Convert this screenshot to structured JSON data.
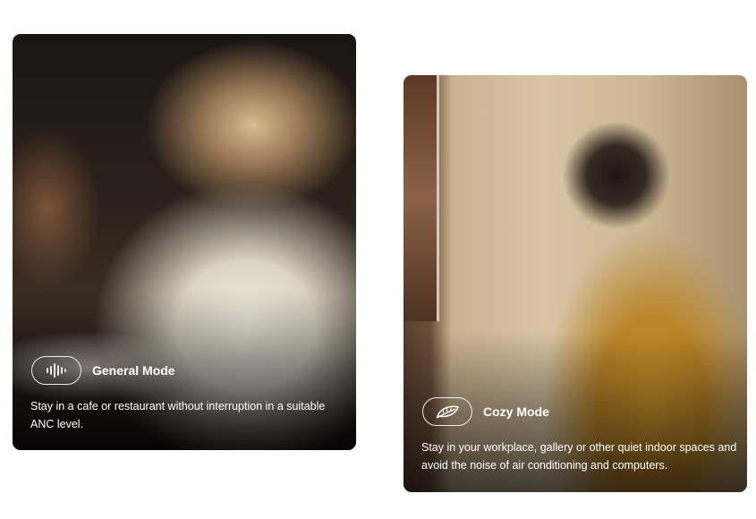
{
  "cards": [
    {
      "mode_title": "General Mode",
      "description": "Stay in a cafe or restaurant without interruption in a suitable ANC level.",
      "icon": "sound-wave-icon"
    },
    {
      "mode_title": "Cozy Mode",
      "description": "Stay in your workplace, gallery or other quiet indoor spaces and avoid the noise of air conditioning and computers.",
      "icon": "leaf-icon"
    }
  ],
  "colors": {
    "text": "#ffffff",
    "page_background": "#ffffff"
  }
}
